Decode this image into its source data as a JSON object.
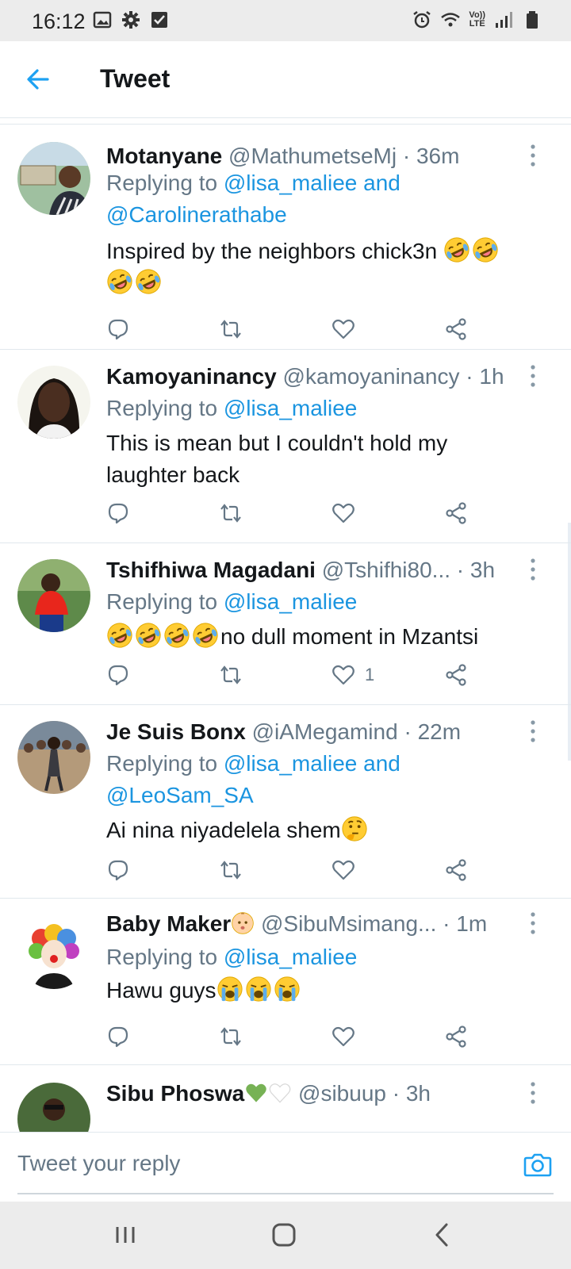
{
  "status_bar": {
    "time": "16:12",
    "left_icons": [
      "image-icon",
      "gear-icon",
      "checkbox-icon"
    ],
    "right_icons": [
      "alarm-icon",
      "wifi-icon",
      "volte-icon",
      "signal-icon",
      "battery-icon"
    ],
    "volte_top": "Vo))",
    "volte_bottom": "LTE"
  },
  "header": {
    "title": "Tweet",
    "back_icon": "arrow-left-icon",
    "accent": "#1da1f2"
  },
  "tweets": [
    {
      "name": "Motanyane",
      "handle": "@MathumetseMj",
      "time": "· 36m",
      "replying_prefix": "Replying to ",
      "replying_line1": "@lisa_maliee and",
      "replying_line2": "@Carolinerathabe",
      "text": "Inspired by the neighbors chick3n",
      "emojis": [
        "rofl",
        "rofl",
        "rofl",
        "rofl"
      ],
      "likes": ""
    },
    {
      "name": "Kamoyaninancy",
      "handle": "@kamoyaninancy",
      "time": "· 1h",
      "replying_prefix": "Replying to ",
      "replying_line1": "@lisa_maliee",
      "text_line1": "This is mean but I couldn't hold my",
      "text_line2": "laughter back",
      "likes": ""
    },
    {
      "name": "Tshifhiwa Magadani",
      "handle": "@Tshifhi80...",
      "time": "· 3h",
      "replying_prefix": "Replying to ",
      "replying_line1": "@lisa_maliee",
      "text": "no dull moment in Mzantsi",
      "emojis": [
        "rofl",
        "rofl",
        "rofl",
        "rofl"
      ],
      "likes": "1"
    },
    {
      "name": "Je Suis Bonx",
      "handle": "@iAMegamind",
      "time": "· 22m",
      "replying_prefix": "Replying to ",
      "replying_line1": "@lisa_maliee and",
      "replying_line2": "@LeoSam_SA",
      "text": "Ai nina niyadelela shem",
      "emojis": [
        "thinking"
      ],
      "likes": ""
    },
    {
      "name": "Baby Maker",
      "handle": "@SibuMsimang...",
      "time": "· 1m",
      "replying_prefix": "Replying to ",
      "replying_line1": "@lisa_maliee",
      "text": "Hawu guys",
      "emojis": [
        "sob",
        "sob",
        "sob"
      ],
      "likes": ""
    },
    {
      "name": "Sibu Phoswa",
      "handle": "@sibuup",
      "time": "· 3h"
    }
  ],
  "reply_bar": {
    "placeholder": "Tweet your reply",
    "camera_icon": "camera-icon"
  },
  "nav_bar": {
    "buttons": [
      "recent-apps-icon",
      "home-icon",
      "back-nav-icon"
    ]
  }
}
